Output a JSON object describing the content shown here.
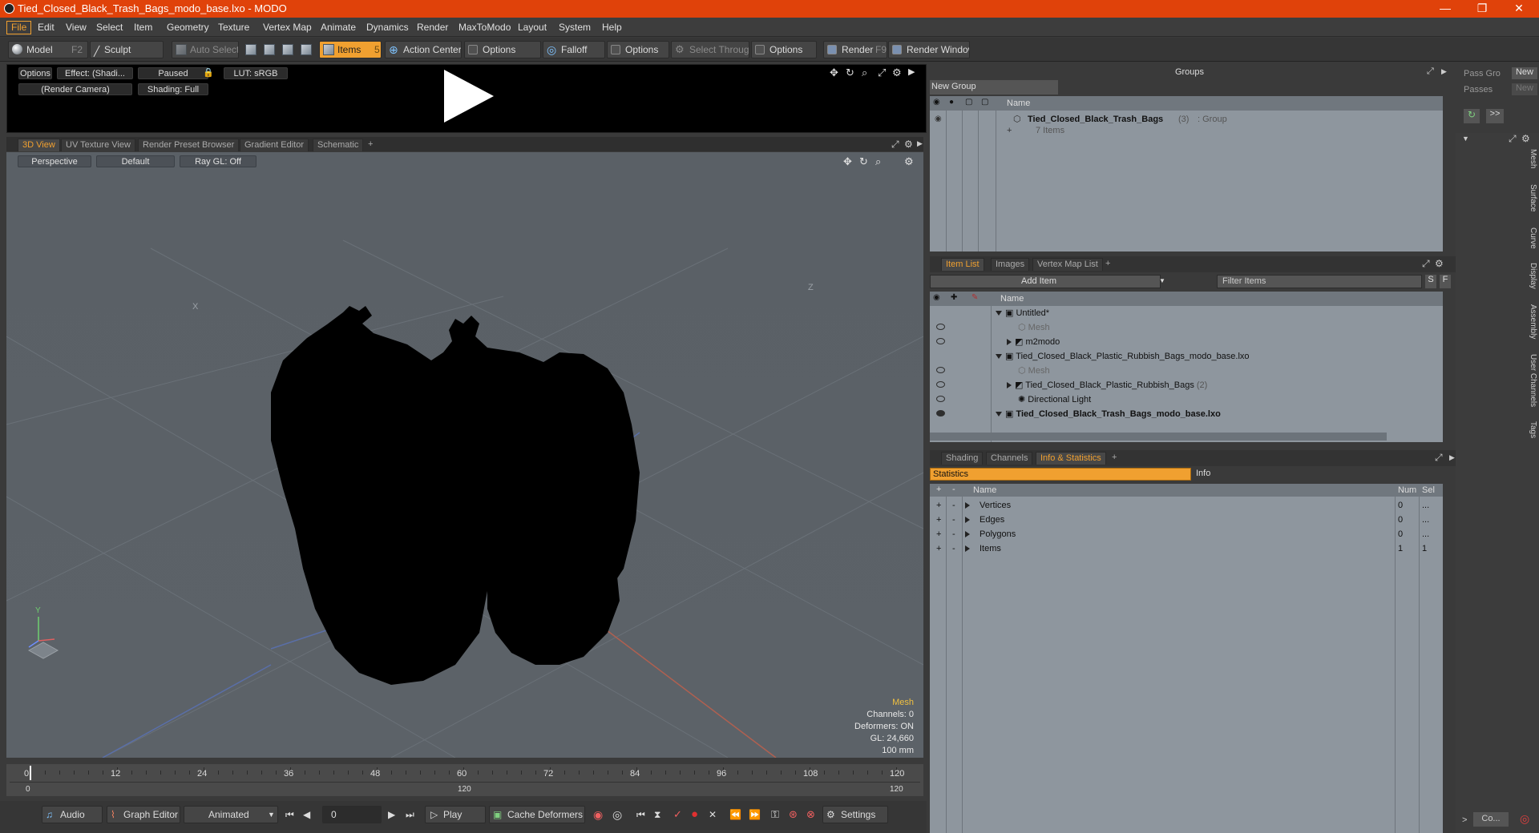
{
  "window": {
    "title": "Tied_Closed_Black_Trash_Bags_modo_base.lxo - MODO",
    "min": "—",
    "max": "❐",
    "close": "✕"
  },
  "menu": [
    "File",
    "Edit",
    "View",
    "Select",
    "Item",
    "Geometry",
    "Texture",
    "Vertex Map",
    "Animate",
    "Dynamics",
    "Render",
    "MaxToModo",
    "Layout",
    "System",
    "Help"
  ],
  "toolbar": {
    "model": "Model",
    "model_key": "F2",
    "sculpt": "Sculpt",
    "auto_select": "Auto Select",
    "items": "Items",
    "items_key": "5",
    "action_center": "Action Center",
    "options1": "Options",
    "falloff": "Falloff",
    "options2": "Options",
    "select_through": "Select Through",
    "options3": "Options",
    "render": "Render",
    "render_key": "F9",
    "render_window": "Render Window"
  },
  "preview": {
    "options": "Options",
    "effect": "Effect: (Shadi...",
    "paused": "Paused",
    "lut": "LUT: sRGB",
    "camera": "(Render Camera)",
    "shading": "Shading: Full"
  },
  "view_tabs": [
    "3D View",
    "UV Texture View",
    "Render Preset Browser",
    "Gradient Editor",
    "Schematic",
    "+"
  ],
  "viewport": {
    "projection": "Perspective",
    "style": "Default",
    "raygl": "Ray GL: Off",
    "hud": [
      "Mesh",
      "Channels: 0",
      "Deformers: ON",
      "GL: 24,660",
      "100 mm"
    ],
    "axis_x": "X",
    "axis_y": "Y",
    "axis_z": "Z"
  },
  "timeline": {
    "ticks": [
      "0",
      "12",
      "24",
      "36",
      "48",
      "60",
      "72",
      "84",
      "96",
      "108",
      "120"
    ],
    "range_start": "0",
    "range_mid": "120",
    "range_end": "120"
  },
  "bottom": {
    "audio": "Audio",
    "graph_editor": "Graph Editor",
    "animated": "Animated",
    "frame": "0",
    "play": "Play",
    "cache_deformers": "Cache Deformers",
    "settings": "Settings"
  },
  "groups": {
    "title": "Groups",
    "new_group": "New Group",
    "col_name": "Name",
    "item_name": "Tied_Closed_Black_Trash_Bags",
    "item_count": "(3)",
    "item_type": ": Group",
    "item_sub": "7 Items"
  },
  "pass": {
    "pass_groups": "Pass Gro",
    "passes": "Passes",
    "new1": "New",
    "new2": "New",
    "more": ">>"
  },
  "itemlist": {
    "tabs": [
      "Item List",
      "Images",
      "Vertex Map List",
      "+"
    ],
    "add_item": "Add Item",
    "filter": "Filter Items",
    "s": "S",
    "f": "F",
    "col_name": "Name",
    "rows": [
      {
        "label": "Untitled*",
        "sub": ""
      },
      {
        "label": "Mesh",
        "sub": ""
      },
      {
        "label": "m2modo",
        "sub": ""
      },
      {
        "label": "Tied_Closed_Black_Plastic_Rubbish_Bags_modo_base.lxo",
        "sub": ""
      },
      {
        "label": "Mesh",
        "sub": ""
      },
      {
        "label": "Tied_Closed_Black_Plastic_Rubbish_Bags",
        "sub": "(2)"
      },
      {
        "label": "Directional Light",
        "sub": ""
      },
      {
        "label": "Tied_Closed_Black_Trash_Bags_modo_base.lxo",
        "sub": ""
      }
    ]
  },
  "stats": {
    "tabs": [
      "Shading",
      "Channels",
      "Info & Statistics",
      "+"
    ],
    "statistics": "Statistics",
    "info": "Info",
    "col_name": "Name",
    "col_num": "Num",
    "col_sel": "Sel",
    "rows": [
      {
        "name": "Vertices",
        "num": "0",
        "sel": "..."
      },
      {
        "name": "Edges",
        "num": "0",
        "sel": "..."
      },
      {
        "name": "Polygons",
        "num": "0",
        "sel": "..."
      },
      {
        "name": "Items",
        "num": "1",
        "sel": "1"
      }
    ]
  },
  "side_tabs": [
    "Mesh",
    "Surface",
    "Curve",
    "Display",
    "Assembly",
    "User Channels",
    "Tags"
  ],
  "bottom_right": {
    "btn": "Co..."
  }
}
